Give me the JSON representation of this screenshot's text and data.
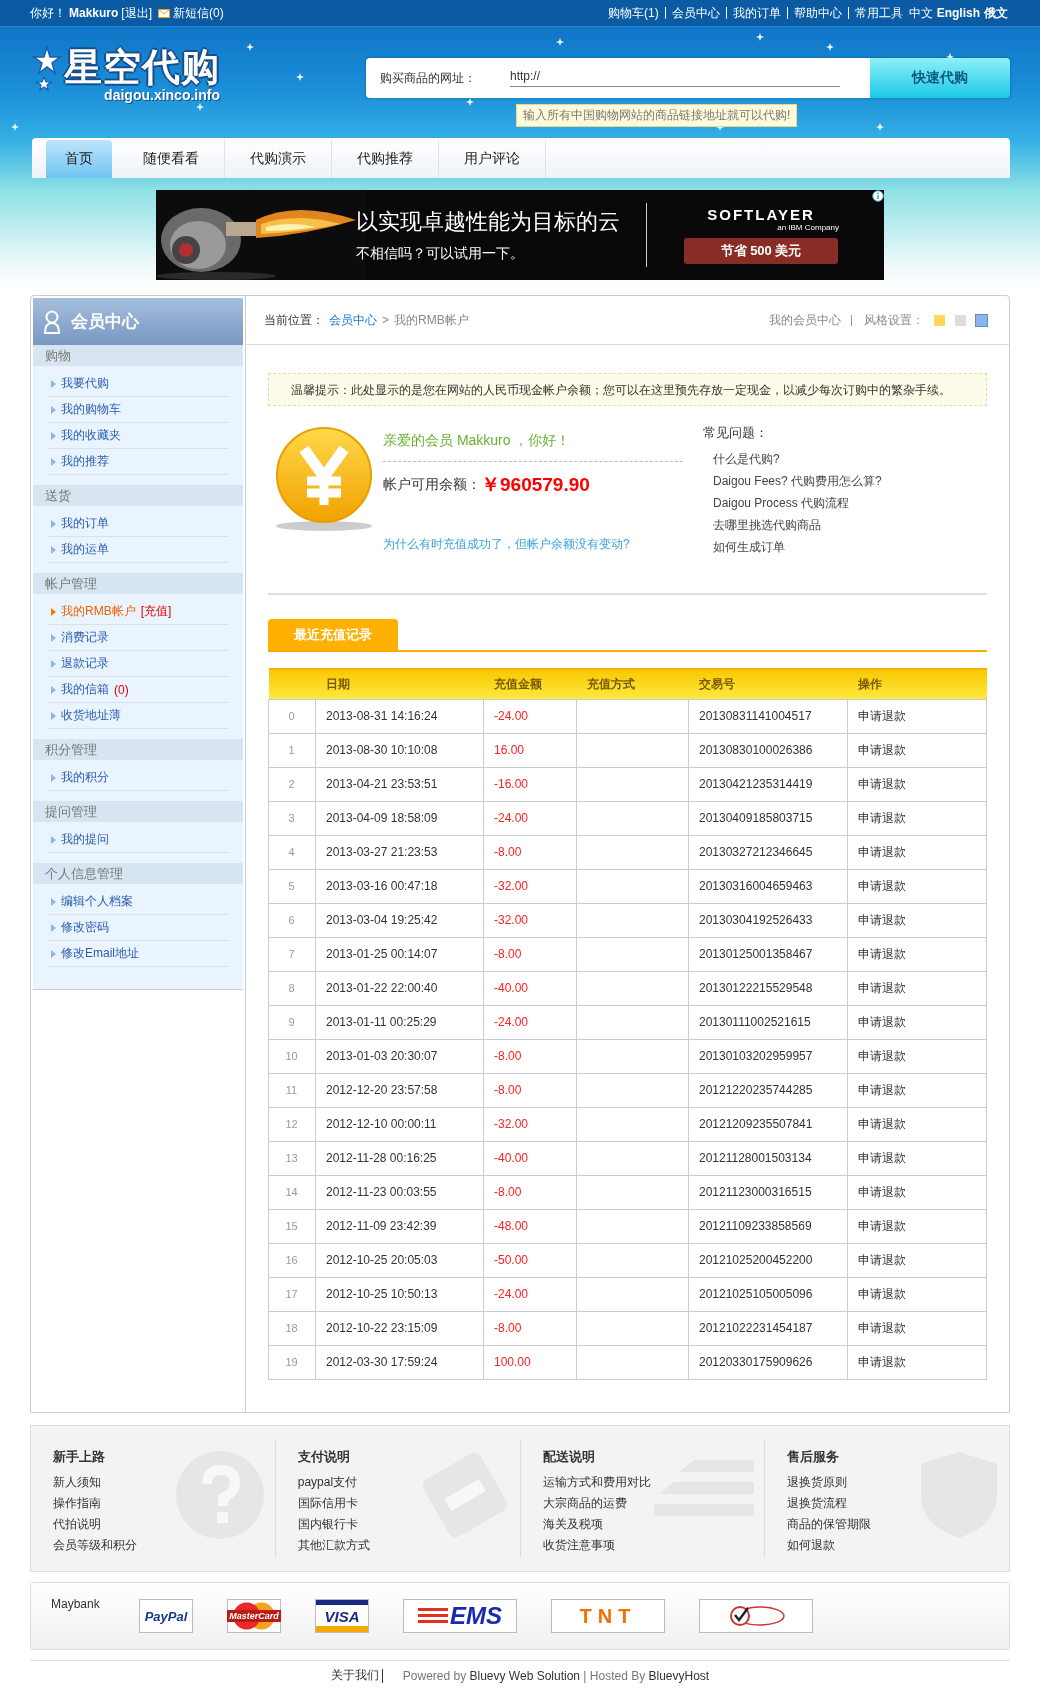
{
  "top_bar": {
    "greeting": "你好！",
    "user": "Makkuro",
    "logout": "[退出]",
    "messages": "新短信(0)",
    "links": [
      "购物车(1)",
      "会员中心",
      "我的订单",
      "帮助中心",
      "常用工具"
    ],
    "languages": [
      "中文",
      "English",
      "俄文"
    ]
  },
  "logo": {
    "name": "星空代购",
    "domain": "daigou.xinco.info"
  },
  "search": {
    "label": "购买商品的网址：",
    "value": "http://",
    "button": "快速代购",
    "hint": "输入所有中国购物网站的商品链接地址就可以代购!"
  },
  "nav": [
    {
      "label": "首页",
      "selected": true
    },
    {
      "label": "随便看看",
      "selected": false
    },
    {
      "label": "代购演示",
      "selected": false
    },
    {
      "label": "代购推荐",
      "selected": false
    },
    {
      "label": "用户评论",
      "selected": false
    }
  ],
  "ad": {
    "headline": "以实现卓越性能为目标的云",
    "subline": "不相信吗？可以试用一下。",
    "brand": "SOFTLAYER",
    "brand_sub": "an IBM Company",
    "button": "节省 500 美元"
  },
  "sidebar": {
    "title": "会员中心",
    "sections": [
      {
        "title": "购物",
        "items": [
          {
            "label": "我要代购",
            "selected": false
          },
          {
            "label": "我的购物车",
            "selected": false
          },
          {
            "label": "我的收藏夹",
            "selected": false
          },
          {
            "label": "我的推荐",
            "selected": false
          }
        ]
      },
      {
        "title": "送货",
        "items": [
          {
            "label": "我的订单",
            "selected": false
          },
          {
            "label": "我的运单",
            "selected": false
          }
        ]
      },
      {
        "title": "帐户管理",
        "items": [
          {
            "label": "我的RMB帐户",
            "badge": "[充值]",
            "selected": true
          },
          {
            "label": "消费记录",
            "selected": false
          },
          {
            "label": "退款记录",
            "selected": false
          },
          {
            "label": "我的信箱",
            "badge": "(0)",
            "selected": false
          },
          {
            "label": "收货地址薄",
            "selected": false
          }
        ]
      },
      {
        "title": "积分管理",
        "items": [
          {
            "label": "我的积分",
            "selected": false
          }
        ]
      },
      {
        "title": "提问管理",
        "items": [
          {
            "label": "我的提问",
            "selected": false
          }
        ]
      },
      {
        "title": "个人信息管理",
        "items": [
          {
            "label": "编辑个人档案",
            "selected": false
          },
          {
            "label": "修改密码",
            "selected": false
          },
          {
            "label": "修改Email地址",
            "selected": false
          }
        ]
      }
    ]
  },
  "breadcrumb": {
    "label": "当前位置：",
    "link": "会员中心",
    "separator": ">",
    "current": "我的RMB帐户"
  },
  "toolbar": {
    "member_link": "我的会员中心",
    "style_label": "风格设置：",
    "swatches": [
      {
        "color": "#fdd85d",
        "selected": false
      },
      {
        "color": "#dcdcdc",
        "selected": false
      },
      {
        "color": "#8bb6ea",
        "selected": true
      }
    ]
  },
  "notice": "温馨提示：此处显示的是您在网站的人民币现金帐户余额；您可以在这里预先存放一定现金，以减少每次订购中的繁杂手续。",
  "account": {
    "greeting": "亲爱的会员 Makkuro ，你好！",
    "balance_label": "帐户可用余额：",
    "balance": "￥960579.90",
    "help_link": "为什么有时充值成功了，但帐户余额没有变动?"
  },
  "faq": {
    "title": "常见问题：",
    "items": [
      "什么是代购?",
      "Daigou Fees? 代购费用怎么算?",
      "Daigou Process 代购流程",
      "去哪里挑选代购商品",
      "如何生成订单"
    ]
  },
  "records": {
    "tab": "最近充值记录",
    "columns": [
      "日期",
      "充值金额",
      "充值方式",
      "交易号",
      "操作"
    ],
    "rows": [
      {
        "index": "0",
        "date": "2013-08-31 14:16:24",
        "amount": "-24.00",
        "txn": "20130831141004517",
        "action": "申请退款"
      },
      {
        "index": "1",
        "date": "2013-08-30 10:10:08",
        "amount": "16.00",
        "txn": "20130830100026386",
        "action": "申请退款"
      },
      {
        "index": "2",
        "date": "2013-04-21 23:53:51",
        "amount": "-16.00",
        "txn": "20130421235314419",
        "action": "申请退款"
      },
      {
        "index": "3",
        "date": "2013-04-09 18:58:09",
        "amount": "-24.00",
        "txn": "20130409185803715",
        "action": "申请退款"
      },
      {
        "index": "4",
        "date": "2013-03-27 21:23:53",
        "amount": "-8.00",
        "txn": "20130327212346645",
        "action": "申请退款"
      },
      {
        "index": "5",
        "date": "2013-03-16 00:47:18",
        "amount": "-32.00",
        "txn": "20130316004659463",
        "action": "申请退款"
      },
      {
        "index": "6",
        "date": "2013-03-04 19:25:42",
        "amount": "-32.00",
        "txn": "20130304192526433",
        "action": "申请退款"
      },
      {
        "index": "7",
        "date": "2013-01-25 00:14:07",
        "amount": "-8.00",
        "txn": "20130125001358467",
        "action": "申请退款"
      },
      {
        "index": "8",
        "date": "2013-01-22 22:00:40",
        "amount": "-40.00",
        "txn": "20130122215529548",
        "action": "申请退款"
      },
      {
        "index": "9",
        "date": "2013-01-11 00:25:29",
        "amount": "-24.00",
        "txn": "20130111002521615",
        "action": "申请退款"
      },
      {
        "index": "10",
        "date": "2013-01-03 20:30:07",
        "amount": "-8.00",
        "txn": "20130103202959957",
        "action": "申请退款"
      },
      {
        "index": "11",
        "date": "2012-12-20 23:57:58",
        "amount": "-8.00",
        "txn": "20121220235744285",
        "action": "申请退款"
      },
      {
        "index": "12",
        "date": "2012-12-10 00:00:11",
        "amount": "-32.00",
        "txn": "20121209235507841",
        "action": "申请退款"
      },
      {
        "index": "13",
        "date": "2012-11-28 00:16:25",
        "amount": "-40.00",
        "txn": "20121128001503134",
        "action": "申请退款"
      },
      {
        "index": "14",
        "date": "2012-11-23 00:03:55",
        "amount": "-8.00",
        "txn": "20121123000316515",
        "action": "申请退款"
      },
      {
        "index": "15",
        "date": "2012-11-09 23:42:39",
        "amount": "-48.00",
        "txn": "20121109233858569",
        "action": "申请退款"
      },
      {
        "index": "16",
        "date": "2012-10-25 20:05:03",
        "amount": "-50.00",
        "txn": "20121025200452200",
        "action": "申请退款"
      },
      {
        "index": "17",
        "date": "2012-10-25 10:50:13",
        "amount": "-24.00",
        "txn": "20121025105005096",
        "action": "申请退款"
      },
      {
        "index": "18",
        "date": "2012-10-22 23:15:09",
        "amount": "-8.00",
        "txn": "20121022231454187",
        "action": "申请退款"
      },
      {
        "index": "19",
        "date": "2012-03-30 17:59:24",
        "amount": "100.00",
        "txn": "20120330175909626",
        "action": "申请退款"
      }
    ]
  },
  "footer": {
    "columns": [
      {
        "kind": "help",
        "title": "新手上路",
        "links": [
          "新人须知",
          "操作指南",
          "代拍说明",
          "会员等级和积分"
        ]
      },
      {
        "kind": "card",
        "title": "支付说明",
        "links": [
          "paypal支付",
          "国际信用卡",
          "国内银行卡",
          "其他汇款方式"
        ]
      },
      {
        "kind": "stripes",
        "title": "配送说明",
        "links": [
          "运输方式和费用对比",
          "大宗商品的运费",
          "海关及税项",
          "收货注意事项"
        ]
      },
      {
        "kind": "shield",
        "title": "售后服务",
        "links": [
          "退换货原则",
          "退换货流程",
          "商品的保管期限",
          "如何退款"
        ]
      }
    ],
    "bank": "Maybank",
    "logos": [
      {
        "kind": "paypal",
        "label": "PayPal"
      },
      {
        "kind": "mastercard",
        "label": "MasterCard"
      },
      {
        "kind": "visa",
        "label": "VISA"
      },
      {
        "kind": "ems",
        "label": "EMS"
      },
      {
        "kind": "tnt",
        "label": "TNT"
      },
      {
        "kind": "verified"
      }
    ],
    "about": "关于我们",
    "credits": "Powered by **Bluevy Web Solution** | Hosted By **BluevyHost**"
  }
}
